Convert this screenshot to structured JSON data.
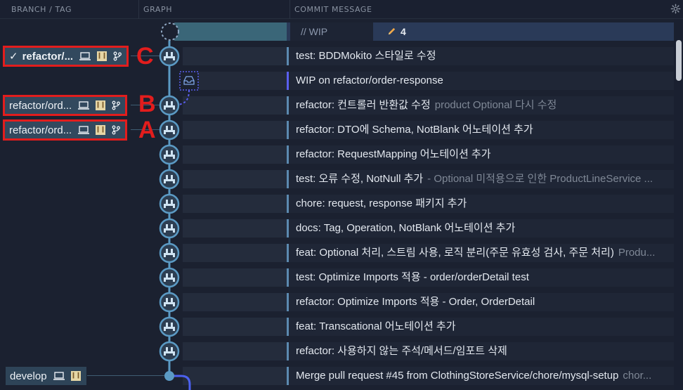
{
  "header": {
    "col_branch": "BRANCH / TAG",
    "col_graph": "GRAPH",
    "col_message": "COMMIT MESSAGE"
  },
  "wip": {
    "label": "// WIP",
    "count": "4"
  },
  "stash": {
    "message": "WIP on refactor/order-response"
  },
  "commits": [
    {
      "message": "test: BDDMokito 스타일로 수정",
      "description": ""
    },
    {
      "message": "refactor: 컨트롤러 반환값 수정",
      "description": "product Optional 다시 수정"
    },
    {
      "message": "refactor: DTO에 Schema, NotBlank 어노테이션 추가",
      "description": ""
    },
    {
      "message": "refactor: RequestMapping 어노테이션 추가",
      "description": ""
    },
    {
      "message": "test: 오류 수정, NotNull 추가",
      "description": "- Optional 미적용으로 인한 ProductLineService ..."
    },
    {
      "message": "chore: request, response 패키지 추가",
      "description": ""
    },
    {
      "message": "docs: Tag, Operation, NotBlank 어노테이션 추가",
      "description": ""
    },
    {
      "message": "feat: Optional 처리, 스트림 사용, 로직 분리(주문 유효성 검사, 주문 처리)",
      "description": "Produ..."
    },
    {
      "message": "test: Optimize Imports 적용 - order/orderDetail test",
      "description": ""
    },
    {
      "message": "refactor: Optimize Imports 적용 - Order, OrderDetail",
      "description": ""
    },
    {
      "message": "feat: Transcational 어노테이션 추가",
      "description": ""
    },
    {
      "message": "refactor: 사용하지 않는 주석/메서드/임포트 삭제",
      "description": ""
    },
    {
      "message": "Merge pull request #45 from ClothingStoreService/chore/mysql-setup",
      "description": "chor..."
    }
  ],
  "branches": {
    "c": {
      "label": "refactor/...",
      "annotation": "C"
    },
    "b": {
      "label": "refactor/ord...",
      "annotation": "B"
    },
    "a": {
      "label": "refactor/ord...",
      "annotation": "A"
    },
    "develop": {
      "label": "develop"
    }
  },
  "colors": {
    "annotation_red": "#e21d1d",
    "graph_line": "#5b9ac4",
    "stash_accent": "#5a5ff0"
  }
}
